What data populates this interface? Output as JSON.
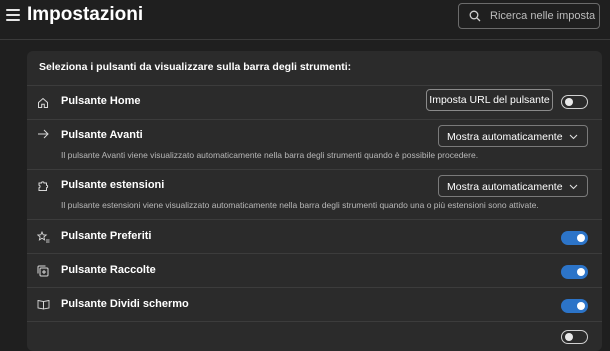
{
  "header": {
    "title": "Impostazioni",
    "search_placeholder": "Ricerca nelle imposta..."
  },
  "section": {
    "title": "Seleziona i pulsanti da visualizzare sulla barra degli strumenti:"
  },
  "rows": [
    {
      "label": "Pulsante Home",
      "icon": "home-icon",
      "button_label": "Imposta URL del pulsante",
      "toggle": "off"
    },
    {
      "label": "Pulsante Avanti",
      "icon": "arrow-right-icon",
      "select_value": "Mostra automaticamente",
      "description": "Il pulsante Avanti viene visualizzato automaticamente nella barra degli strumenti quando è possibile procedere."
    },
    {
      "label": "Pulsante estensioni",
      "icon": "puzzle-icon",
      "select_value": "Mostra automaticamente",
      "description": "Il pulsante estensioni viene visualizzato automaticamente nella barra degli strumenti quando una o più estensioni sono attivate."
    },
    {
      "label": "Pulsante Preferiti",
      "icon": "star-list-icon",
      "toggle": "on"
    },
    {
      "label": "Pulsante Raccolte",
      "icon": "collections-icon",
      "toggle": "on"
    },
    {
      "label": "Pulsante Dividi schermo",
      "icon": "split-screen-icon",
      "toggle": "on"
    }
  ],
  "colors": {
    "accent": "#2c74c8",
    "background": "#1f1f1f",
    "card": "#2b2b2b"
  }
}
